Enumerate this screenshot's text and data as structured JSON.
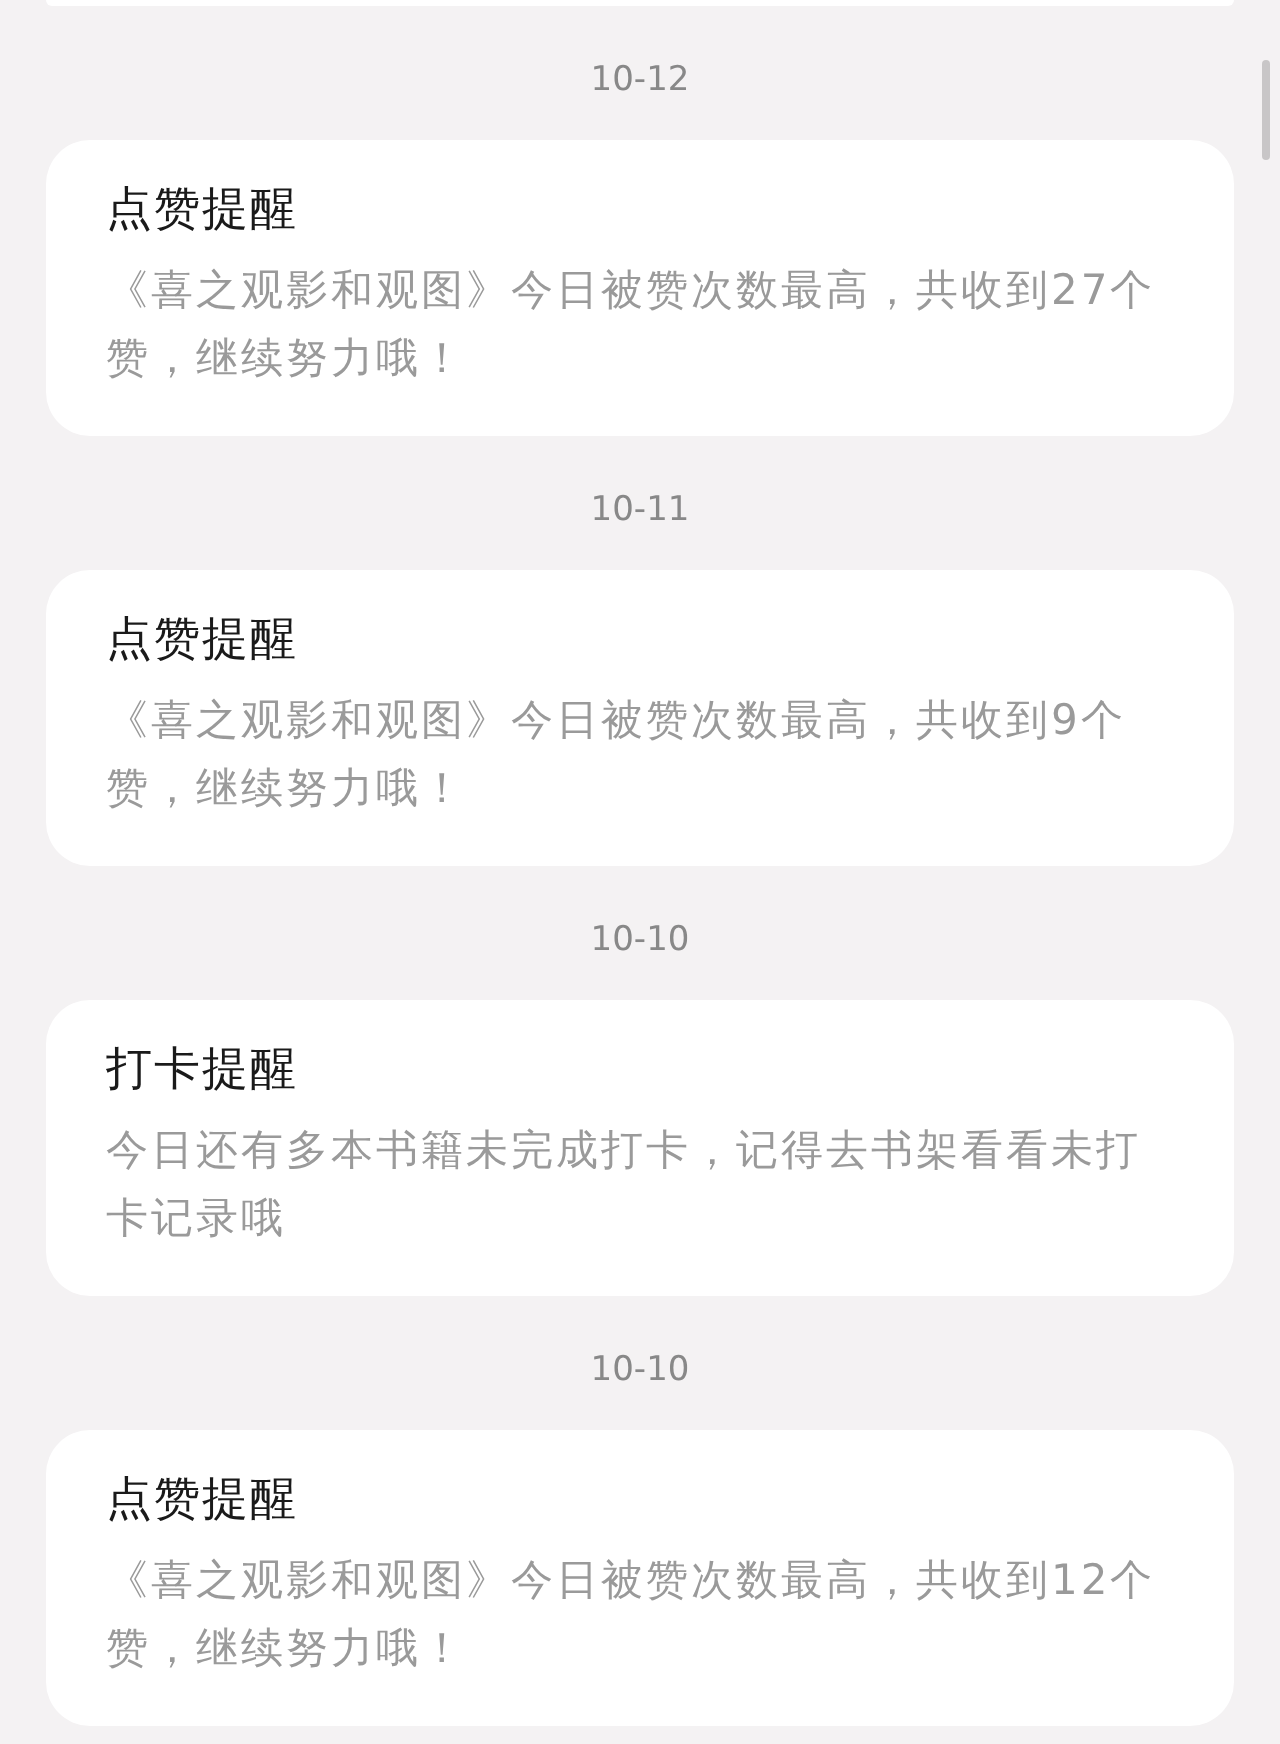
{
  "notifications": [
    {
      "date": "10-12",
      "title": "点赞提醒",
      "body": "《喜之观影和观图》今日被赞次数最高，共收到27个赞，继续努力哦！"
    },
    {
      "date": "10-11",
      "title": "点赞提醒",
      "body": "《喜之观影和观图》今日被赞次数最高，共收到9个赞，继续努力哦！"
    },
    {
      "date": "10-10",
      "title": "打卡提醒",
      "body": "今日还有多本书籍未完成打卡，记得去书架看看未打卡记录哦"
    },
    {
      "date": "10-10",
      "title": "点赞提醒",
      "body": "《喜之观影和观图》今日被赞次数最高，共收到12个赞，继续努力哦！"
    }
  ]
}
